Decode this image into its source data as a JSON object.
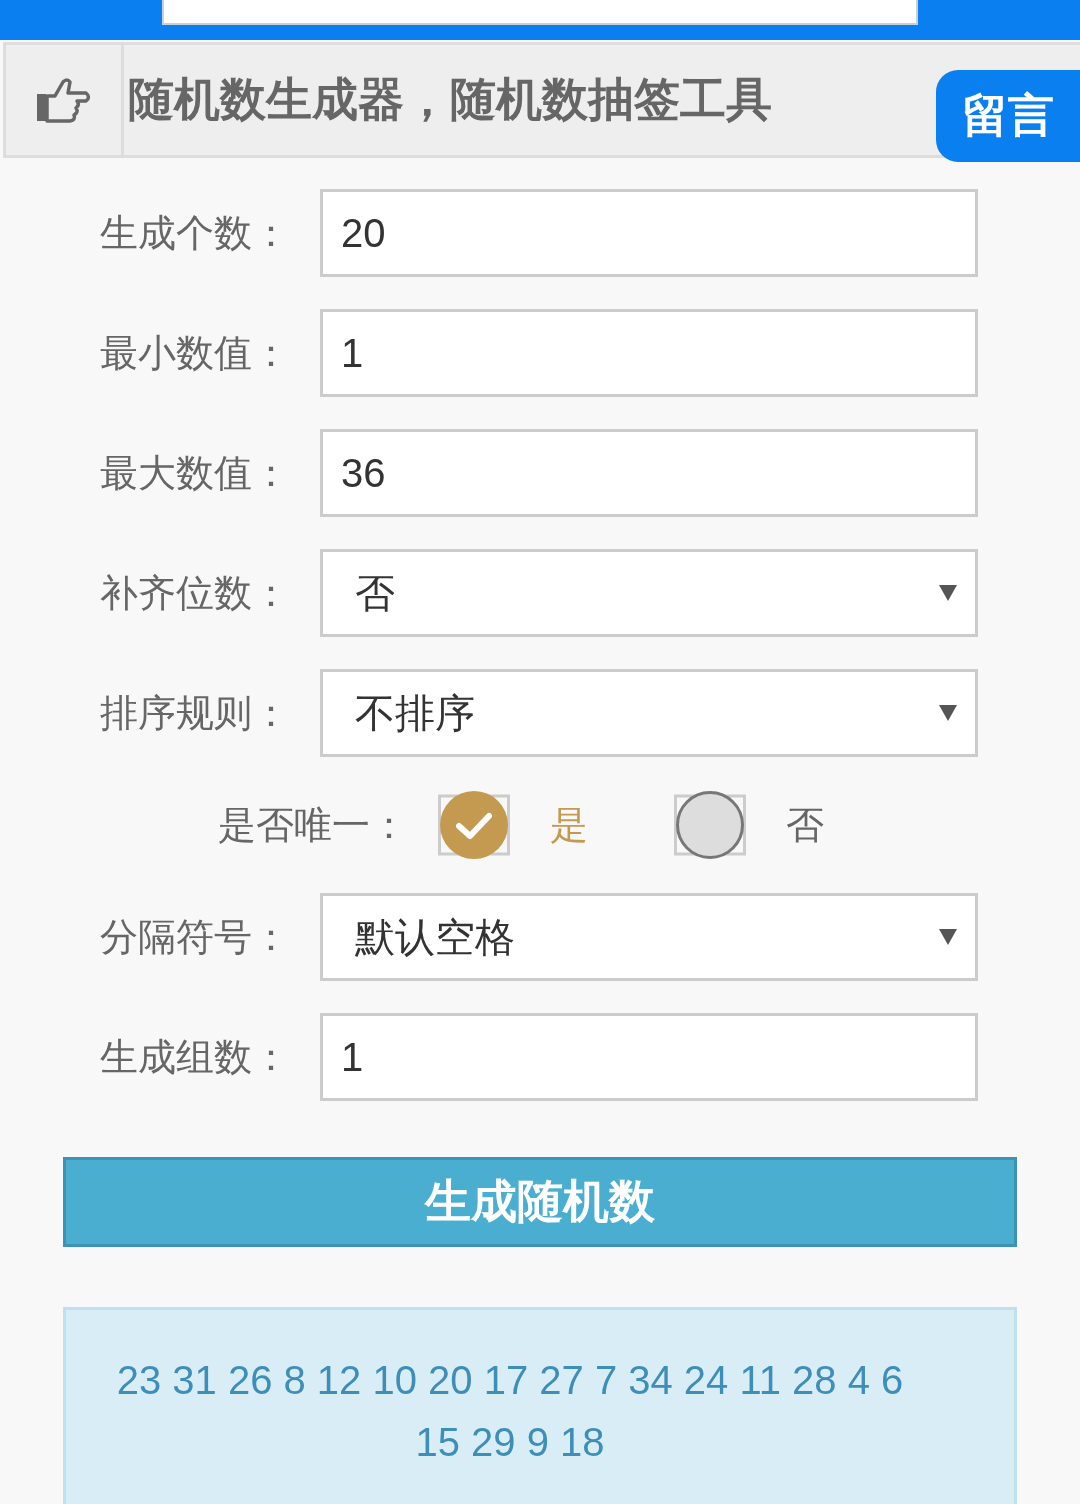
{
  "header": {
    "title": "随机数生成器，随机数抽签工具",
    "message_button": "留言"
  },
  "form": {
    "fields": [
      {
        "kind": "input",
        "label": "生成个数：",
        "value": "20"
      },
      {
        "kind": "input",
        "label": "最小数值：",
        "value": "1"
      },
      {
        "kind": "input",
        "label": "最大数值：",
        "value": "36"
      },
      {
        "kind": "select",
        "label": "补齐位数：",
        "value": "否"
      },
      {
        "kind": "select",
        "label": "排序规则：",
        "value": "不排序"
      },
      {
        "kind": "radio",
        "label": "是否唯一：",
        "options": [
          {
            "label": "是",
            "selected": true
          },
          {
            "label": "否",
            "selected": false
          }
        ]
      },
      {
        "kind": "select",
        "label": "分隔符号：",
        "value": "默认空格"
      },
      {
        "kind": "input",
        "label": "生成组数：",
        "value": "1"
      }
    ]
  },
  "generate_button": "生成随机数",
  "result": "23 31 26 8 12 10 20 17 27 7 34 24 11 28 4 6 15 29 9 18"
}
